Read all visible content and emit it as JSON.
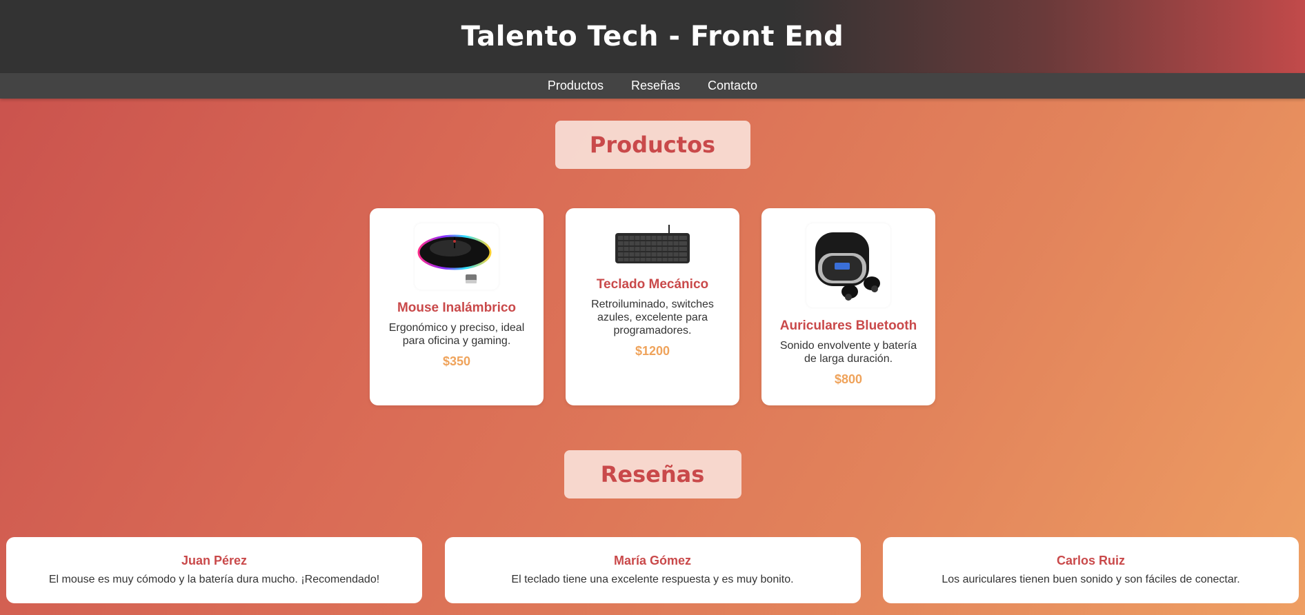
{
  "header": {
    "title": "Talento Tech - Front End"
  },
  "nav": {
    "items": [
      "Productos",
      "Reseñas",
      "Contacto"
    ]
  },
  "products_section": {
    "title": "Productos",
    "items": [
      {
        "name": "Mouse Inalámbrico",
        "description": "Ergonómico y preciso, ideal para oficina y gaming.",
        "price": "$350",
        "image": "wireless-mouse-image"
      },
      {
        "name": "Teclado Mecánico",
        "description": "Retroiluminado, switches azules, excelente para programadores.",
        "price": "$1200",
        "image": "keyboard-image"
      },
      {
        "name": "Auriculares Bluetooth",
        "description": "Sonido envolvente y batería de larga duración.",
        "price": "$800",
        "image": "earbuds-image"
      }
    ]
  },
  "reviews_section": {
    "title": "Reseñas",
    "items": [
      {
        "author": "Juan Pérez",
        "text": "El mouse es muy cómodo y la batería dura mucho. ¡Recomendado!"
      },
      {
        "author": "María Gómez",
        "text": "El teclado tiene una excelente respuesta y es muy bonito."
      },
      {
        "author": "Carlos Ruiz",
        "text": "Los auriculares tienen buen sonido y son fáciles de conectar."
      }
    ]
  },
  "colors": {
    "header_bg": "#333333",
    "nav_bg": "#444444",
    "accent": "#c9494a",
    "price": "#efa35b"
  }
}
